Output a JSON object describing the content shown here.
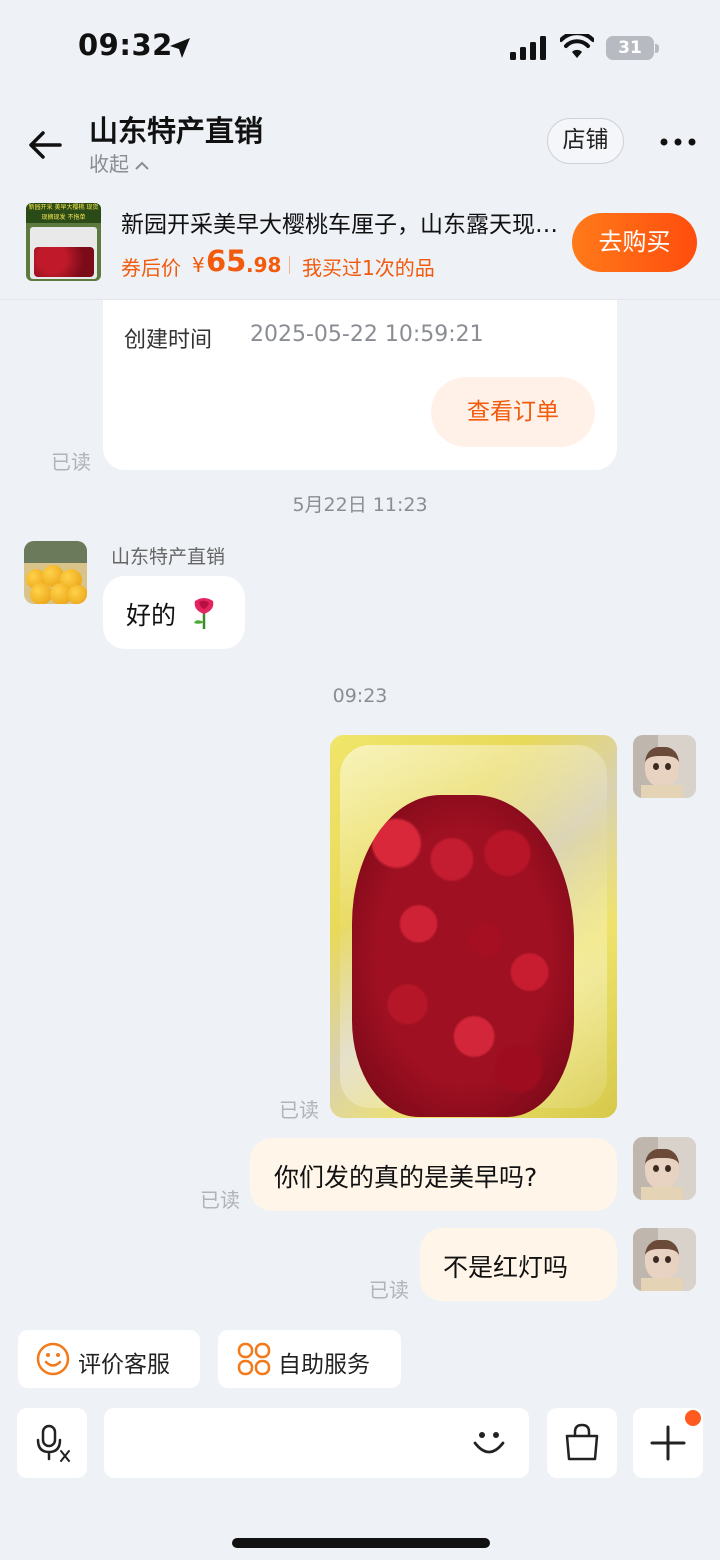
{
  "status_bar": {
    "time": "09:32",
    "battery": "31"
  },
  "header": {
    "shop_name": "山东特产直销",
    "collapse": "收起",
    "shop_button": "店铺"
  },
  "product": {
    "title": "新园开采美早大樱桃车厘子，山东露天现摘大樱桃",
    "thumb_banner": "新园开采 美早大樱桃 现货现摘现发 不拖单",
    "price_label": "券后价",
    "currency": "¥",
    "price_int": "65",
    "price_dec": ".98",
    "bought": "我买过1次的品",
    "buy_button": "去购买"
  },
  "order_card": {
    "created_label": "创建时间",
    "created_value": "2025-05-22 10:59:21",
    "view_button": "查看订单",
    "read": "已读"
  },
  "timestamps": {
    "first": "5月22日 11:23",
    "second": "09:23"
  },
  "seller_message": {
    "name": "山东特产直销",
    "text": "好的"
  },
  "user_messages": [
    {
      "type": "image",
      "read": "已读"
    },
    {
      "type": "text",
      "text": "你们发的真的是美早吗?",
      "read": "已读"
    },
    {
      "type": "text",
      "text": "不是红灯吗",
      "read": "已读"
    }
  ],
  "quick_actions": [
    {
      "label": "评价客服",
      "icon": "smile-icon"
    },
    {
      "label": "自助服务",
      "icon": "grid-flower-icon"
    }
  ],
  "input_bar": {
    "icons": [
      "voice-translate-icon",
      "emoji-icon",
      "shopping-bag-icon",
      "plus-icon"
    ]
  },
  "colors": {
    "accent": "#f25a0c",
    "background": "#eef1f6",
    "outgoing_bubble": "#fff5e9"
  }
}
